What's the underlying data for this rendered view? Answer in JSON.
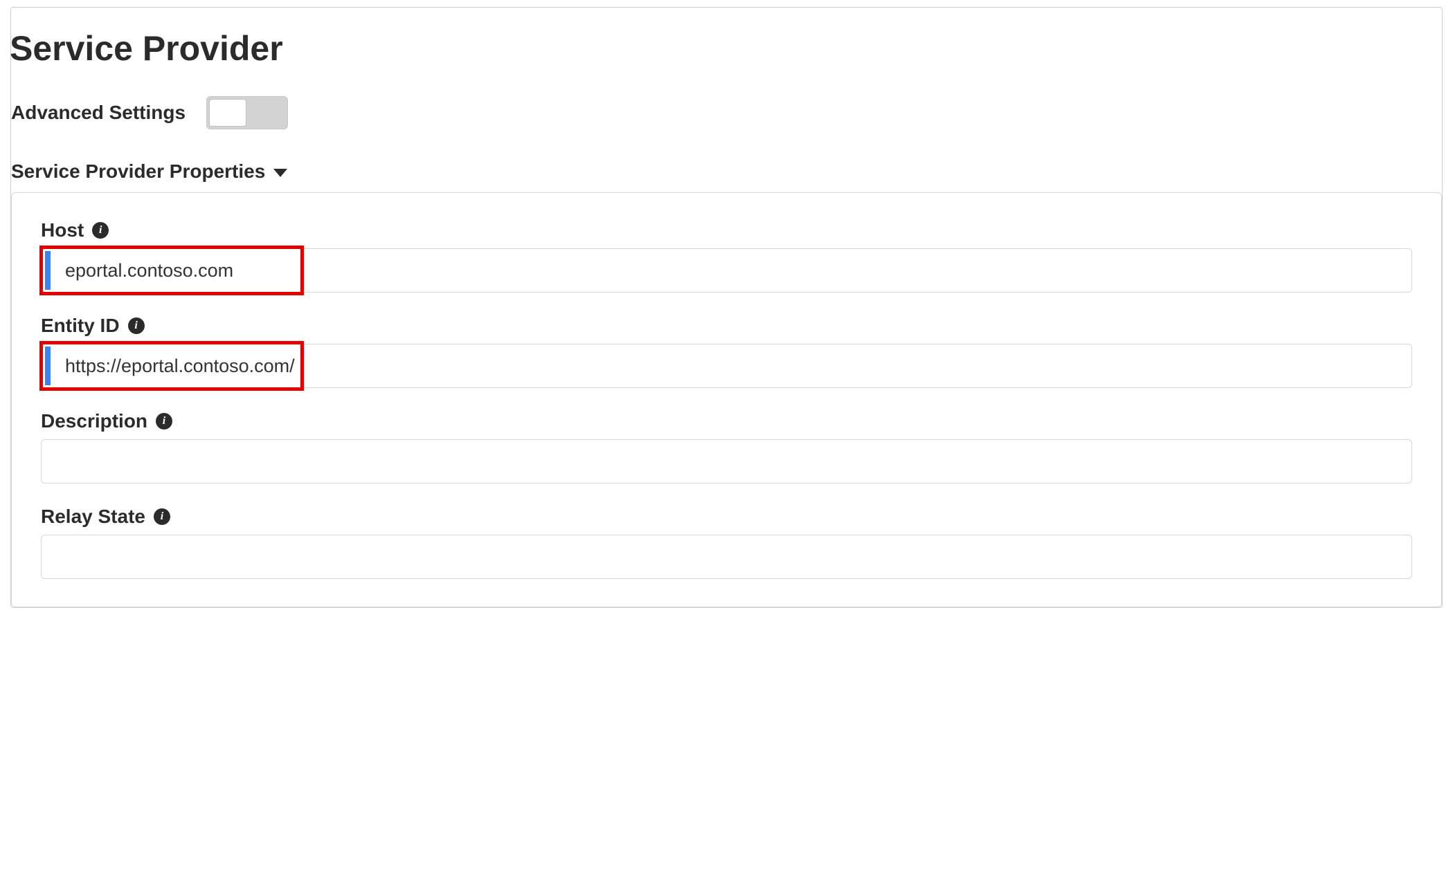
{
  "page": {
    "title": "Service Provider"
  },
  "advanced": {
    "label": "Advanced Settings",
    "enabled": false
  },
  "section": {
    "title": "Service Provider Properties"
  },
  "fields": {
    "host": {
      "label": "Host",
      "value": "eportal.contoso.com"
    },
    "entity_id": {
      "label": "Entity ID",
      "value": "https://eportal.contoso.com/"
    },
    "description": {
      "label": "Description",
      "value": ""
    },
    "relay_state": {
      "label": "Relay State",
      "value": ""
    }
  }
}
